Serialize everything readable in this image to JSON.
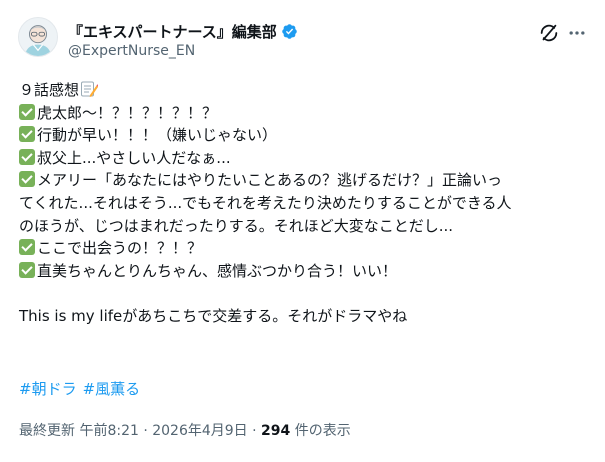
{
  "post": {
    "author": {
      "display_name": "『エキスパートナース』編集部",
      "handle": "@ExpertNurse_EN",
      "verified": true,
      "brand_color": "#1d9bf0"
    },
    "icons": {
      "grok": "grok-icon",
      "more": "more-icon",
      "check": "white-check-mark-emoji",
      "memo": "memo-pencil-emoji"
    },
    "lines": [
      {
        "check": false,
        "text": "９話感想",
        "memo": true
      },
      {
        "check": true,
        "text": "虎太郎〜！？！？！？！？"
      },
      {
        "check": true,
        "text": "行動が早い！！！（嫌いじゃない）"
      },
      {
        "check": true,
        "text": "叔父上...やさしい人だなぁ..."
      },
      {
        "check": true,
        "text": "メアリー「あなたにはやりたいことあるの？逃げるだけ？」正論いっ"
      },
      {
        "check": false,
        "text": "てくれた...それはそう...でもそれを考えたり決めたりすることができる人"
      },
      {
        "check": false,
        "text": "のほうが、じつはまれだったりする。それほど大変なことだし..."
      },
      {
        "check": true,
        "text": "ここで出会うの！？！？"
      },
      {
        "check": true,
        "text": "直美ちゃんとりんちゃん、感情ぶつかり合う！いい！"
      },
      {
        "blank": true
      },
      {
        "check": false,
        "text": "This is my lifeがあちこちで交差する。それがドラマやね"
      }
    ],
    "hashtags": [
      "#朝ドラ",
      "#風薫る"
    ],
    "meta": {
      "updated": "最終更新 午前8:21 · 2026年4月9日 · ",
      "views_count": "294",
      "views_label": " 件の表示"
    }
  }
}
